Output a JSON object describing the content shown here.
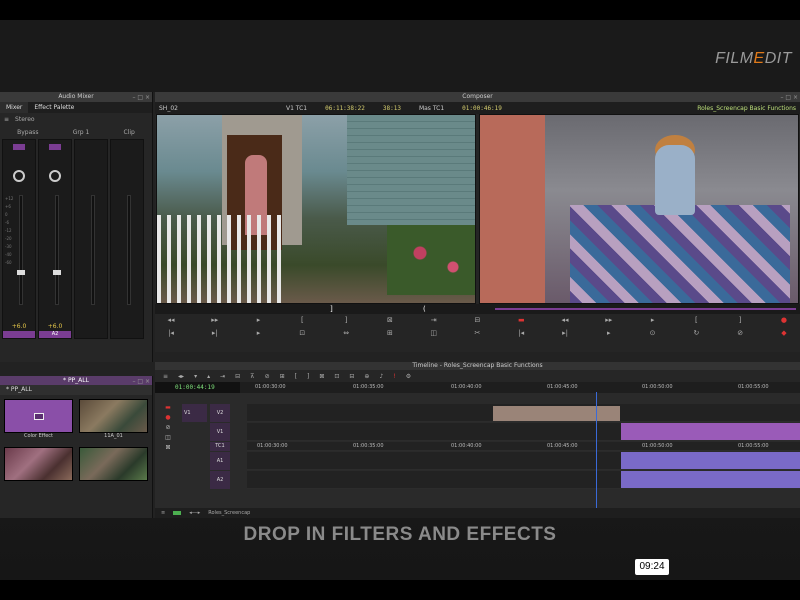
{
  "brand": {
    "logo_prefix": "FILM",
    "logo_accent": "E",
    "logo_suffix": "DIT"
  },
  "mixer": {
    "title": "Audio Mixer",
    "tabs": [
      "Mixer",
      "Effect Palette"
    ],
    "toolbar": {
      "mode": "Stereo"
    },
    "toolbar2": {
      "bypass": "Bypass",
      "grp": "Grp 1",
      "clip": "Clip"
    },
    "strips": [
      {
        "value": "+6.0",
        "foot": ""
      },
      {
        "value": "+6.0",
        "foot": "A2"
      },
      {
        "value": "",
        "foot": ""
      },
      {
        "value": "",
        "foot": ""
      }
    ],
    "scale_ticks": [
      "+12",
      "+6",
      "0",
      "-6",
      "-12",
      "-20",
      "-30",
      "-40",
      "-60"
    ]
  },
  "bin": {
    "title": "* PP_ALL",
    "tab": "* PP_ALL",
    "items": [
      {
        "label": "Color Effect",
        "kind": "color"
      },
      {
        "label": "11A_01",
        "kind": "room"
      },
      {
        "label": "",
        "kind": "bed"
      },
      {
        "label": "",
        "kind": "door"
      }
    ]
  },
  "composer": {
    "title": "Composer",
    "source_clip": "SH_02",
    "source_track": "V1 TC1",
    "source_tc": "06:11:38:22",
    "duration": "38:13",
    "mas_label": "Mas TC1",
    "record_tc": "01:00:46:19",
    "sequence": "Roles_Screencap Basic Functions"
  },
  "timeline": {
    "title": "Timeline - Roles_Screencap Basic Functions",
    "position_tc": "01:00:44:19",
    "ruler_ticks": [
      "01:00:30:00",
      "01:00:35:00",
      "01:00:40:00",
      "01:00:45:00",
      "01:00:50:00",
      "01:00:55:00"
    ],
    "ruler_ticks_lower": [
      "01:00:30:00",
      "01:00:35:00",
      "01:00:40:00",
      "01:00:45:00",
      "01:00:50:00",
      "01:00:55:00"
    ],
    "tracks": [
      {
        "left": "V1",
        "right": "V2"
      },
      {
        "left": "",
        "right": "V1"
      },
      {
        "left": "",
        "right": "TC1"
      },
      {
        "left": "",
        "right": "A1"
      },
      {
        "left": "",
        "right": "A2"
      }
    ],
    "footer_label": "Roles_Screencap"
  },
  "caption": "DROP IN FILTERS AND EFFECTS",
  "clock": "09:24",
  "colors": {
    "accent": "#7b3d93",
    "clip_video": "#9a5bb8",
    "clip_audio": "#7a6ac8",
    "clip_tan": "#9a8478",
    "playhead": "#3a6ad8",
    "logo_accent": "#e07a1a"
  }
}
